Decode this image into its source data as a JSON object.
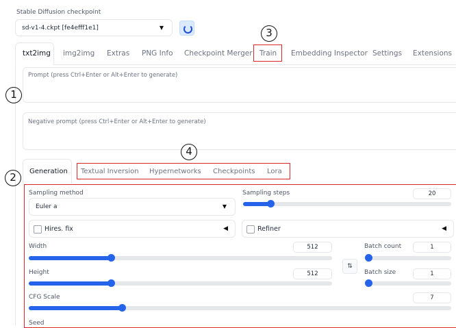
{
  "checkpoint": {
    "label": "Stable Diffusion checkpoint",
    "value": "sd-v1-4.ckpt [fe4efff1e1]",
    "refresh_icon": "refresh-icon"
  },
  "main_tabs": [
    {
      "label": "txt2img",
      "active": true
    },
    {
      "label": "img2img"
    },
    {
      "label": "Extras"
    },
    {
      "label": "PNG Info"
    },
    {
      "label": "Checkpoint Merger"
    },
    {
      "label": "Train"
    },
    {
      "label": "Embedding Inspector"
    },
    {
      "label": "Settings"
    },
    {
      "label": "Extensions"
    }
  ],
  "prompt": {
    "placeholder": "Prompt (press Ctrl+Enter or Alt+Enter to generate)"
  },
  "negative_prompt": {
    "placeholder": "Negative prompt (press Ctrl+Enter or Alt+Enter to generate)"
  },
  "sub_tabs": [
    {
      "label": "Generation",
      "active": true
    },
    {
      "label": "Textual Inversion"
    },
    {
      "label": "Hypernetworks"
    },
    {
      "label": "Checkpoints"
    },
    {
      "label": "Lora"
    }
  ],
  "generation": {
    "sampling_method": {
      "label": "Sampling method",
      "value": "Euler a"
    },
    "sampling_steps": {
      "label": "Sampling steps",
      "value": "20",
      "fraction": 0.13
    },
    "hires_fix": {
      "label": "Hires. fix"
    },
    "refiner": {
      "label": "Refiner"
    },
    "width": {
      "label": "Width",
      "value": "512",
      "fraction": 0.27
    },
    "height": {
      "label": "Height",
      "value": "512",
      "fraction": 0.27
    },
    "batch_count": {
      "label": "Batch count",
      "value": "1",
      "fraction": 0.0
    },
    "batch_size": {
      "label": "Batch size",
      "value": "1",
      "fraction": 0.0
    },
    "swap_icon": "swap-arrows-icon",
    "cfg_scale": {
      "label": "CFG Scale",
      "value": "7",
      "fraction": 0.22
    },
    "seed": {
      "label": "Seed"
    }
  },
  "annotations": [
    "1",
    "2",
    "3",
    "4"
  ],
  "colors": {
    "accent": "#2563eb",
    "highlight": "#dc2626"
  }
}
